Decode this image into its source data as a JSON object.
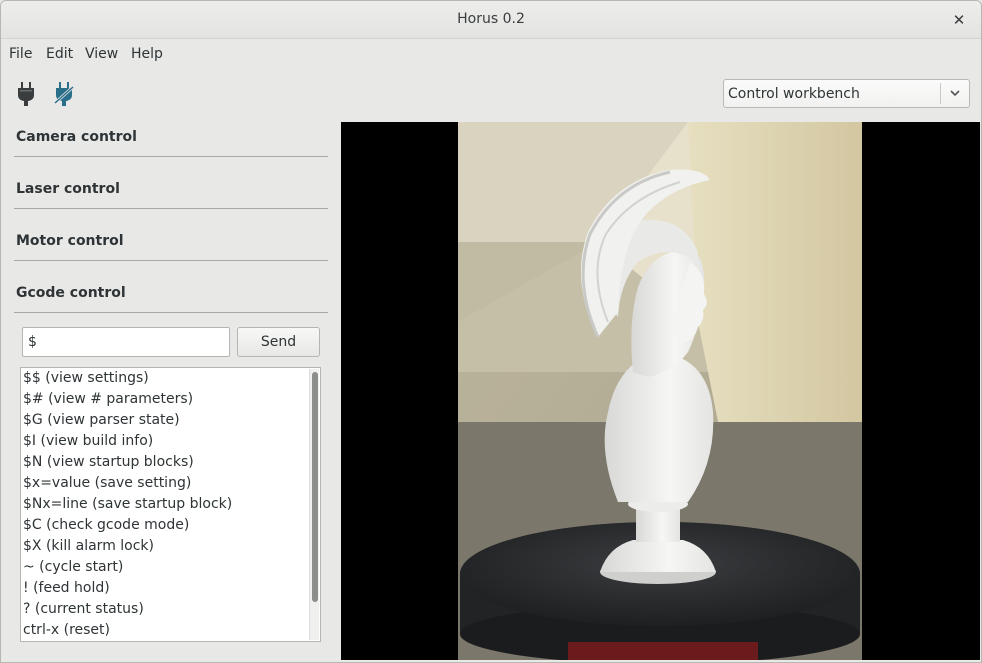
{
  "window": {
    "title": "Horus 0.2",
    "close_glyph": "✕"
  },
  "menu": [
    {
      "label": "File"
    },
    {
      "label": "Edit"
    },
    {
      "label": "View"
    },
    {
      "label": "Help"
    }
  ],
  "toolbar": {
    "icons": [
      {
        "name": "connect-plug-icon"
      },
      {
        "name": "disconnect-plug-icon"
      }
    ],
    "workbench": {
      "selected": "Control workbench"
    }
  },
  "sections": [
    {
      "label": "Camera control"
    },
    {
      "label": "Laser control"
    },
    {
      "label": "Motor control"
    },
    {
      "label": "Gcode control"
    }
  ],
  "gcode": {
    "input_value": "$",
    "send_label": "Send",
    "commands": [
      "$$ (view settings)",
      "$# (view # parameters)",
      "$G (view parser state)",
      "$I (view build info)",
      "$N (view startup blocks)",
      "$x=value (save setting)",
      "$Nx=line (save startup block)",
      "$C (check gcode mode)",
      "$X (kill alarm lock)",
      "~ (cycle start)",
      "! (feed hold)",
      "? (current status)",
      "ctrl-x (reset)"
    ]
  },
  "colors": {
    "accent_icon": "#2a6f8a",
    "dark_icon": "#3a3d3e"
  }
}
